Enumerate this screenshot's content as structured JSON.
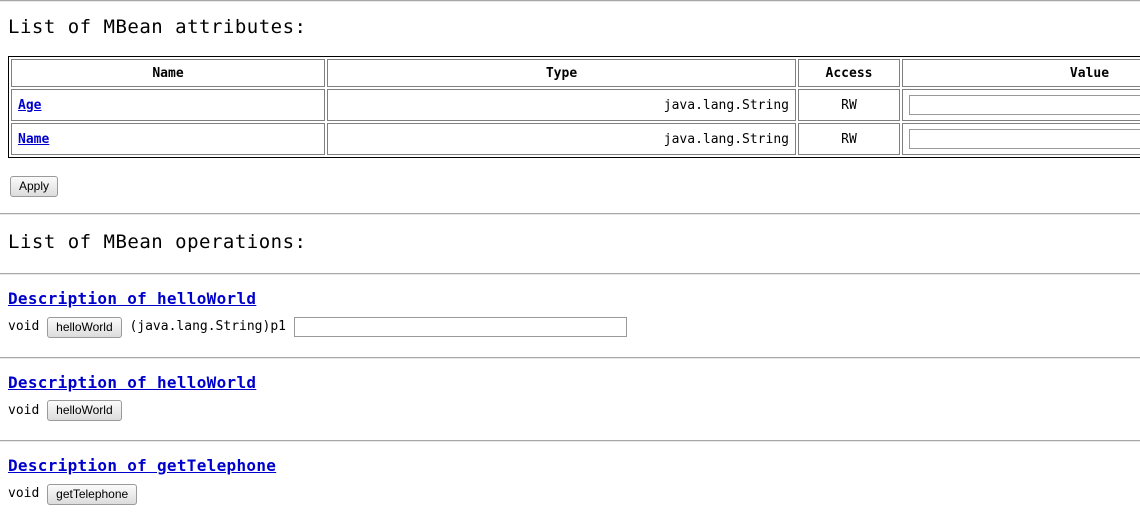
{
  "attributes_section": {
    "heading": "List of MBean attributes:",
    "columns": {
      "name": "Name",
      "type": "Type",
      "access": "Access",
      "value": "Value"
    },
    "rows": [
      {
        "name": "Age",
        "type": "java.lang.String",
        "access": "RW",
        "value": ""
      },
      {
        "name": "Name",
        "type": "java.lang.String",
        "access": "RW",
        "value": ""
      }
    ],
    "apply_label": "Apply"
  },
  "operations_section": {
    "heading": "List of MBean operations:",
    "operations": [
      {
        "description_link": "Description of helloWorld",
        "return_type": "void",
        "invoke_label": "helloWorld",
        "param_signature": "(java.lang.String)p1",
        "param_value": "",
        "has_param": true
      },
      {
        "description_link": "Description of helloWorld",
        "return_type": "void",
        "invoke_label": "helloWorld",
        "param_signature": "",
        "param_value": "",
        "has_param": false
      },
      {
        "description_link": "Description of getTelephone",
        "return_type": "void",
        "invoke_label": "getTelephone",
        "param_signature": "",
        "param_value": "",
        "has_param": false
      }
    ]
  },
  "colors": {
    "link": "#0000cc",
    "text": "#000000",
    "rule": "#a8a8a8",
    "table_border": "#000000",
    "cell_border": "#808080",
    "input_border": "#999999",
    "background": "#ffffff"
  }
}
